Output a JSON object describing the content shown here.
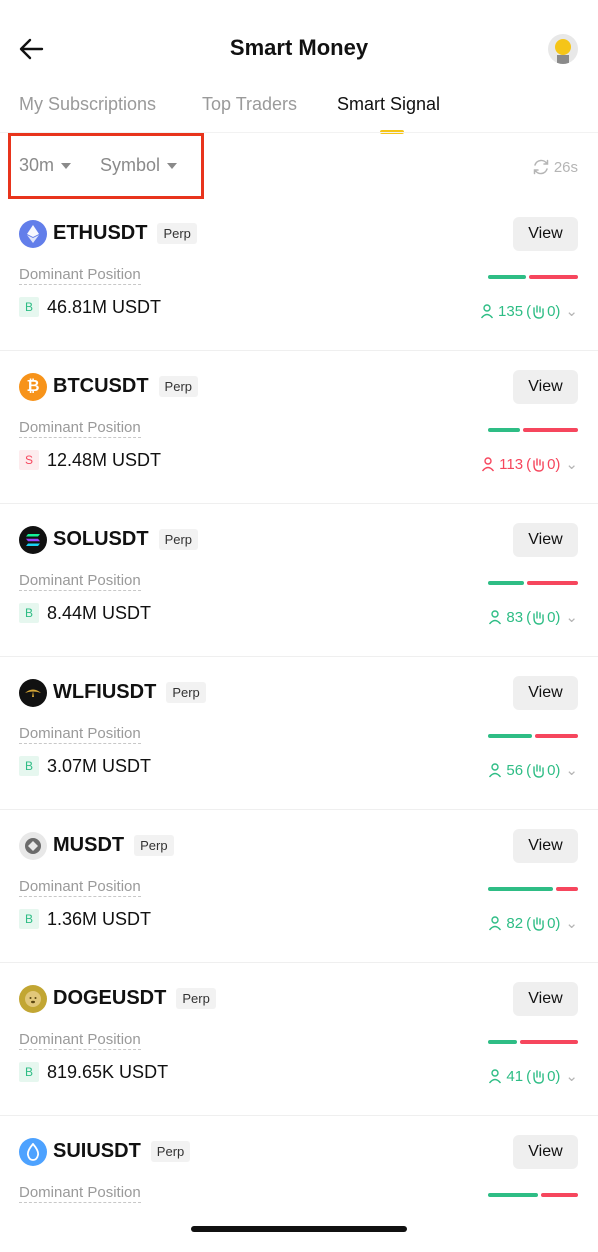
{
  "header": {
    "title": "Smart Money"
  },
  "tabs": [
    {
      "label": "My Subscriptions"
    },
    {
      "label": "Top Traders"
    },
    {
      "label": "Smart Signal"
    }
  ],
  "filters": {
    "interval": "30m",
    "symbol": "Symbol",
    "refresh": "26s"
  },
  "colors": {
    "long": "#2ebd85",
    "short": "#f6465d",
    "accent": "#f5c518",
    "highlight": "#e8341c"
  },
  "signals": [
    {
      "symbol": "ETHUSDT",
      "type": "Perp",
      "view": "View",
      "label": "Dominant Position",
      "side": "B",
      "amount": "46.81M USDT",
      "traders": "135",
      "extra": "0",
      "long_ratio": 0.42,
      "icon": "ethereum-icon"
    },
    {
      "symbol": "BTCUSDT",
      "type": "Perp",
      "view": "View",
      "label": "Dominant Position",
      "side": "S",
      "amount": "12.48M USDT",
      "traders": "113",
      "extra": "0",
      "long_ratio": 0.36,
      "icon": "bitcoin-icon"
    },
    {
      "symbol": "SOLUSDT",
      "type": "Perp",
      "view": "View",
      "label": "Dominant Position",
      "side": "B",
      "amount": "8.44M USDT",
      "traders": "83",
      "extra": "0",
      "long_ratio": 0.4,
      "icon": "solana-icon"
    },
    {
      "symbol": "WLFIUSDT",
      "type": "Perp",
      "view": "View",
      "label": "Dominant Position",
      "side": "B",
      "amount": "3.07M USDT",
      "traders": "56",
      "extra": "0",
      "long_ratio": 0.5,
      "icon": "wlfi-icon"
    },
    {
      "symbol": "MUSDT",
      "type": "Perp",
      "view": "View",
      "label": "Dominant Position",
      "side": "B",
      "amount": "1.36M USDT",
      "traders": "82",
      "extra": "0",
      "long_ratio": 0.73,
      "icon": "m-token-icon"
    },
    {
      "symbol": "DOGEUSDT",
      "type": "Perp",
      "view": "View",
      "label": "Dominant Position",
      "side": "B",
      "amount": "819.65K USDT",
      "traders": "41",
      "extra": "0",
      "long_ratio": 0.33,
      "icon": "doge-icon"
    },
    {
      "symbol": "SUIUSDT",
      "type": "Perp",
      "view": "View",
      "label": "Dominant Position",
      "side": "",
      "amount": "",
      "traders": "",
      "extra": "",
      "long_ratio": 0.57,
      "icon": "sui-icon"
    }
  ]
}
